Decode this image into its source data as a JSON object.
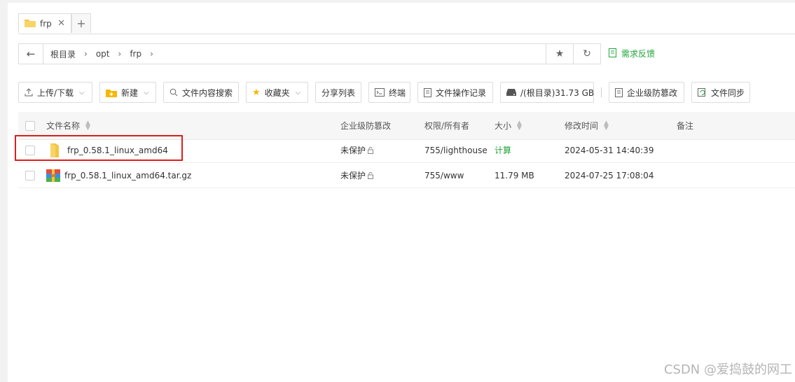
{
  "tabs": [
    {
      "label": "frp"
    }
  ],
  "tab_add_label": "+",
  "tab_close_label": "✕",
  "nav": {
    "back": "←",
    "crumbs": [
      "根目录",
      "opt",
      "frp"
    ],
    "sep": "›",
    "star": "★",
    "refresh": "↻"
  },
  "feedback_label": "需求反馈",
  "toolbar": {
    "upload": "上传/下载",
    "new": "新建",
    "search": "文件内容搜索",
    "favorites": "收藏夹",
    "share_list": "分享列表",
    "terminal": "终端",
    "op_log": "文件操作记录",
    "disk": "/(根目录)31.73 GB",
    "tamper": "企业级防篡改",
    "sync": "文件同步"
  },
  "table": {
    "headers": {
      "name": "文件名称",
      "tamper": "企业级防篡改",
      "perm": "权限/所有者",
      "size": "大小",
      "mtime": "修改时间",
      "note": "备注"
    },
    "rows": [
      {
        "icon": "folder-icon",
        "name": "frp_0.58.1_linux_amd64",
        "tamper": "未保护",
        "perm": "755/lighthouse",
        "size": "计算",
        "mtime": "2024-05-31 14:40:39"
      },
      {
        "icon": "archive-icon",
        "name": "frp_0.58.1_linux_amd64.tar.gz",
        "tamper": "未保护",
        "perm": "755/www",
        "size": "11.79 MB",
        "mtime": "2024-07-25 17:08:04"
      }
    ]
  },
  "watermark": "CSDN @爱捣鼓的网工",
  "colors": {
    "accent": "#20a53a",
    "highlight": "#d9201c",
    "folder": "#f5c542"
  }
}
